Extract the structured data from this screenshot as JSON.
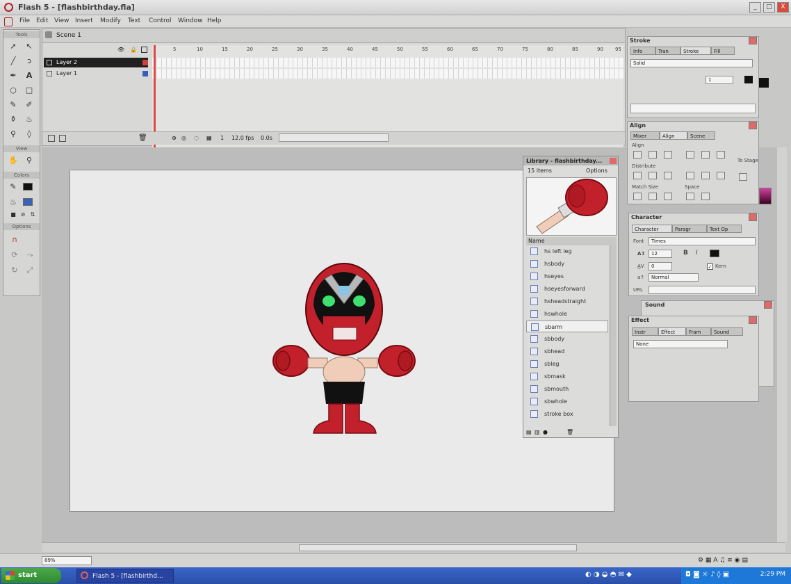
{
  "window": {
    "title": "Flash 5 - [flashbirthday.fla]",
    "min": "_",
    "max": "□",
    "close": "X"
  },
  "menu": [
    "File",
    "Edit",
    "View",
    "Insert",
    "Modify",
    "Text",
    "Control",
    "Window",
    "Help"
  ],
  "toolbox": {
    "sections": {
      "tools": "Tools",
      "view": "View",
      "colors": "Colors",
      "options": "Options"
    },
    "tools": [
      "arrow-icon",
      "subselect-icon",
      "line-icon",
      "lasso-icon",
      "pen-icon",
      "text-icon",
      "oval-icon",
      "rectangle-icon",
      "pencil-icon",
      "brush-icon",
      "ink-bottle-icon",
      "paint-bucket-icon",
      "dropper-icon",
      "eraser-icon"
    ]
  },
  "timeline": {
    "scene": "Scene 1",
    "layers": [
      "Layer 2",
      "Layer 1"
    ],
    "frame_numbers": [
      "5",
      "10",
      "15",
      "20",
      "25",
      "30",
      "35",
      "40",
      "45",
      "50",
      "55",
      "60",
      "65",
      "70",
      "75",
      "80",
      "85",
      "90",
      "95"
    ],
    "current_frame": "1",
    "fps": "12.0 fps",
    "elapsed": "0.0s"
  },
  "library": {
    "title": "Library - flashbirthday...",
    "count": "15 items",
    "options": "Options",
    "column_name": "Name",
    "items": [
      "hs left leg",
      "hsbody",
      "hseyes",
      "hseyesforward",
      "hsheadstraight",
      "hswhole",
      "sbarm",
      "sbbody",
      "sbhead",
      "sbleg",
      "sbmask",
      "sbmouth",
      "sbwhole",
      "stroke box"
    ],
    "selected": "sbarm"
  },
  "panels": {
    "stroke": {
      "title": "Stroke",
      "tabs": [
        "Info",
        "Tran",
        "Stroke",
        "Fill"
      ],
      "style": "Solid",
      "weight": "1"
    },
    "align": {
      "title": "Align",
      "tabs": [
        "Mixer",
        "Align",
        "Scene"
      ],
      "labels": [
        "Align",
        "Distribute",
        "Match Size",
        "Space",
        "To Stage"
      ]
    },
    "character": {
      "title": "Character",
      "tabs": [
        "Character",
        "Paragr",
        "Text Op"
      ],
      "font_label": "Font",
      "font": "Times",
      "size": "12",
      "tracking": "0",
      "kern": "Kern",
      "baseline": "Normal",
      "url_label": "URL",
      "bold": "B",
      "italic": "I"
    },
    "sound": {
      "title": "Sound"
    },
    "effect": {
      "title": "Effect",
      "tabs": [
        "Instr",
        "Effect",
        "Fram",
        "Sound"
      ],
      "value": "None"
    }
  },
  "status": {
    "zoom": "89%"
  },
  "taskbar": {
    "start": "start",
    "task": "Flash 5 - [flashbirthd...",
    "clock": "2:29 PM"
  },
  "colors": {
    "accent_red": "#c2202a",
    "skin": "#f0cdb8",
    "eye": "#3ee070"
  }
}
